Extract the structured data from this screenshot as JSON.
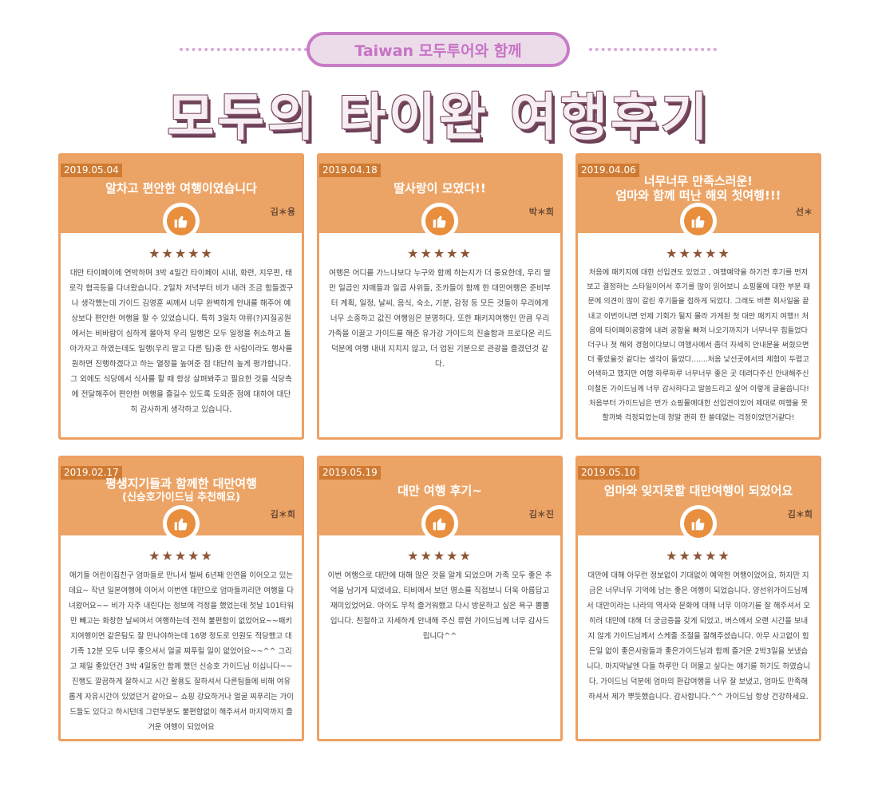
{
  "header": {
    "pill_text": "Taiwan 모두투어와 함께",
    "main_title": "모두의 타이완 여행후기"
  },
  "icons": {
    "thumbs_up": "thumbs-up-icon"
  },
  "colors": {
    "card_orange": "#eca466",
    "date_brown": "#d07b33",
    "pill_purple": "#c87bc6"
  },
  "reviews": [
    {
      "date": "2019.05.04",
      "title": "알차고 편안한 여행이였습니다",
      "author": "김＊용",
      "stars": "★★★★★",
      "text": "대만 타이페이에 연박하며 3박 4일간 타이페이 시내, 화련, 지우펀, 태로각 협곡등을 다녀왔습니다. 2일차 저녁부터 비가 내려 조금 힘들겠구나 생각했는데 가이드 김영훈 씨께서 너무 완벽하게 안내를 해주어 예상보다 편안한 여행을 할 수 있었습니다. 특히 3일차 야류(?)지질공원에서는 비바람이 심하게 몰아쳐 우리 일행은 모두 일정을 취소하고 돌아가자고 하였는데도 일행(우리 말고 다른 팀)중 한 사람이라도 행사를 원하면 진행하겠다고 하는 열정을 높여준 점 대단히 높게 평가합니다. 그 외에도 식당에서 식사를 할 때 항상 살펴봐주고 필요한 것을 식당측에 전달해주어 편안한 여행을 즐길수 있도록 도와준 점에 대하여 대단히 감사하게 생각하고 있습니다."
    },
    {
      "date": "2019.04.18",
      "title": "딸사랑이 모였다!!",
      "author": "박＊희",
      "stars": "★★★★★",
      "text": "여행은 어디를 가느냐보다 누구와 함께 하는지가 더 중요한데, 우리 딸만 일곱인 자매들과 일곱 사위들, 조카들이 함께 한 대만여행은 준비부터 계획, 일정, 날씨, 음식, 숙소, 기분, 감정 등 모든 것들이 우리에게 너무 소중하고 값진 여행임은 분명하다. 또한 패키지여행인 만큼 우리 가족을 이끌고 가이드를 해준 유가강 가이드의 진솔함과 프로다운 리드 덕분에 여행 내내 지치지 않고, 더 업된 기분으로 관광을 즐겼던것 같다."
    },
    {
      "date": "2019.04.06",
      "title": "너무너무 만족스러운!",
      "subtitle": "엄마와 함께 떠난 해외 첫여행!!!",
      "author": "선＊",
      "stars": "★★★★★",
      "text": "처음에 패키지에 대한 선입견도 있었고 , 여행예약을 하기전 후기를 먼저 보고 결정하는 스타일이어서 후기를 많이 읽어보니 쇼핑몰에 대한 부분 때문에 의견이 많이 갈린 후기들을 접하게 되었다. 그래도 바쁜 회사일을 끝내고 이번이니면 언제 기회가 될지 몰라 가게된 첫 대만 패키지 여행!! 처음에 타이페이공항에 내려 공항을 빠져 나오기까지가 너무너무 힘들었다 더구나 첫 해외 경험이다보니 여행사에서 좀더 자세히 안내문을 써줬으면 더 좋았을것 같다는 생각이 들었다.......처음 낯선곳에서의 체험이 두렵고 어색하고 했지만 여행 하루하루 너무너무 좋은 곳 데려다주신 안내해주신 이철돈 가이드님께 너무 감사하다고 말씀드리고 싶어 이렇게 글을씁니다! 처음부터 가이드님은 먼가 쇼핑몰에대한 선입견이있어 제대로 여행을 못할까봐 걱정되었는데 정말 괜히 한 쓸데없는 걱정이었던거같다!"
    },
    {
      "date": "2019.02.17",
      "title": "평생지기들과 함께한 대만여행",
      "subtitle": "(신승호가이드님 추천해요)",
      "author": "김＊희",
      "stars": "★★★★★",
      "text": "애기들 어린이집친구 엄마들로 만나서 벌써 6년째 인연을 이어오고 있는데요~ 작년 일본여행에 이어서 이번엔 대만으로 엄마들끼리만 여행을 다녀왔어요~~ 비가 자주 내린다는 정보에 걱정을 했었는데 첫날 101타워만 빼고는 화창한 날씨여서 여행하는데 전혀 불편함이 없었어요~~패키지여행이면 같은팀도 잘 만나야하는데 16명 정도로 인원도 적당했고 대가족 12분 모두 너무 좋으셔서 얼굴 찌푸릴 일이 없었어요~~^^ 그리고 제일 좋았던건 3박 4일동안 함께 했던 신승호 가이드님 이십니다~~ 진행도 깔끔하게 잘하시고 시간 활용도 잘하셔서 다른팀들에 비해 여유롭게 자유시간이 있었던거 같아요~ 쇼핑 강요하거나 얼굴 찌푸리는 가이드들도 있다고 하시던데 그런부분도 불편함없이 해주셔서 마지막까지 즐거운 여행이 되었어요"
    },
    {
      "date": "2019.05.19",
      "title": "대만 여행 후기~",
      "author": "김＊진",
      "stars": "★★★★★",
      "text": "이번 여행으로 대만에 대해 많은 것을 알게 되었으며 가족 모두 좋은 추억을 남기게 되었네요. 티비에서 보던 명소를 직접보니 더욱 아름답고 재미있었어요. 아이도 무척 즐거워했고 다시 방문하고 싶은 욕구 뿜뿜입니다. 친절하고 자세하게 안내해 주신 류현 가이드님께 너무 감사드립니다^^"
    },
    {
      "date": "2019.05.10",
      "title": "엄마와 잊지못할 대만여행이 되었어요",
      "author": "김＊희",
      "stars": "★★★★★",
      "text": "대만에 대해 아무런 정보없이 기대없이 예약한 여행이었어요. 하지만 지금은 너무너무 기억에 남는 좋은 여행이 되었습니다. 양선위가이드님께서 대만이라는 나라의 역사와 문화에 대해 너무 이야기를 잘 해주셔서 오히려 대만에 대해 더 궁금증을 갖게 되었고, 버스에서 오랜 시간을 보내지 않게 가이드님께서 스케줄 조절을 잘해주셨습니다. 아무 사고없이 힘든일 없이 좋은사람들과 좋은가이드님과 함께 즐거운 2박3일을 보냈습니다. 마지막날엔 다들 하루만 더 머물고 싶다는 얘기를 하기도 하였습니다. 가이드님 덕분에 엄마의 환갑여행을 너무 잘 보냈고, 엄마도 만족해하셔서 제가 뿌듯했습니다. 감사합니다.^^ 가이드님 항상 건강하세요."
    }
  ]
}
